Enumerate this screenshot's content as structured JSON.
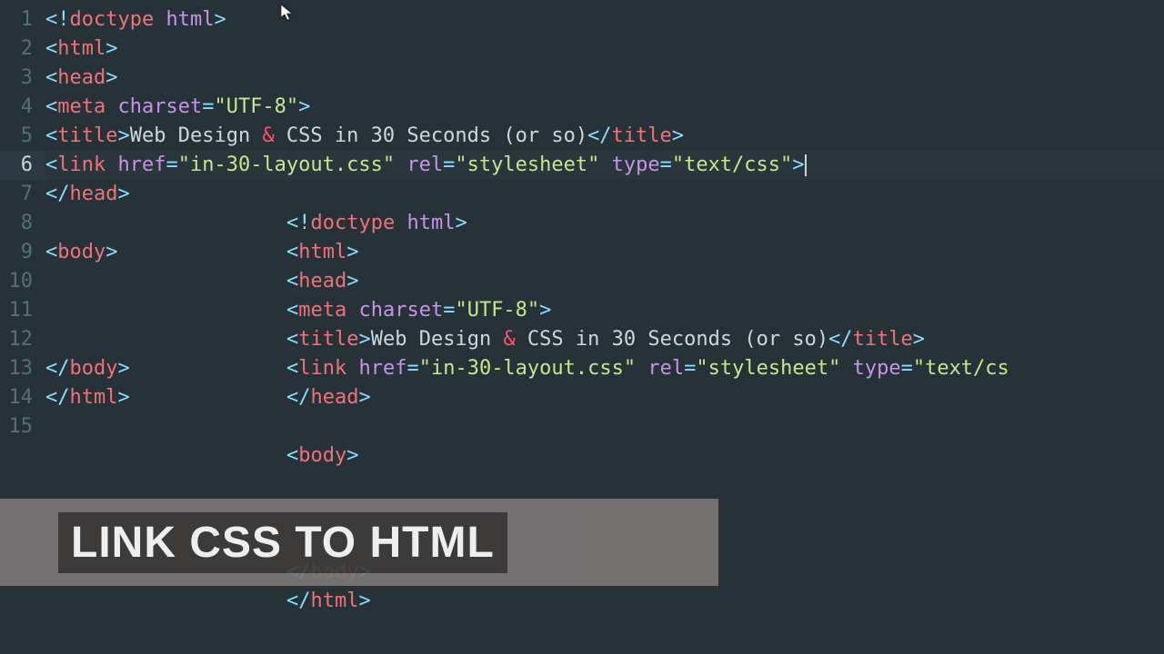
{
  "banner": {
    "text": "LINK CSS TO HTML"
  },
  "active_line": 6,
  "main_lines": [
    {
      "n": 1,
      "tokens": [
        {
          "c": "b",
          "t": "<!"
        },
        {
          "c": "t",
          "t": "doctype"
        },
        {
          "c": "x",
          "t": " "
        },
        {
          "c": "a",
          "t": "html"
        },
        {
          "c": "b",
          "t": ">"
        }
      ]
    },
    {
      "n": 2,
      "tokens": [
        {
          "c": "b",
          "t": "<"
        },
        {
          "c": "t",
          "t": "html"
        },
        {
          "c": "b",
          "t": ">"
        }
      ]
    },
    {
      "n": 3,
      "tokens": [
        {
          "c": "b",
          "t": "<"
        },
        {
          "c": "t",
          "t": "head"
        },
        {
          "c": "b",
          "t": ">"
        }
      ]
    },
    {
      "n": 4,
      "tokens": [
        {
          "c": "b",
          "t": "<"
        },
        {
          "c": "t",
          "t": "meta"
        },
        {
          "c": "x",
          "t": " "
        },
        {
          "c": "a",
          "t": "charset"
        },
        {
          "c": "o",
          "t": "="
        },
        {
          "c": "s",
          "t": "\"UTF-8\""
        },
        {
          "c": "b",
          "t": ">"
        }
      ]
    },
    {
      "n": 5,
      "tokens": [
        {
          "c": "b",
          "t": "<"
        },
        {
          "c": "t",
          "t": "title"
        },
        {
          "c": "b",
          "t": ">"
        },
        {
          "c": "x",
          "t": "Web Design "
        },
        {
          "c": "e",
          "t": "&"
        },
        {
          "c": "x",
          "t": " CSS in 30 Seconds (or so)"
        },
        {
          "c": "b",
          "t": "</"
        },
        {
          "c": "t",
          "t": "title"
        },
        {
          "c": "b",
          "t": ">"
        }
      ]
    },
    {
      "n": 6,
      "tokens": [
        {
          "c": "b",
          "t": "<"
        },
        {
          "c": "t",
          "t": "link"
        },
        {
          "c": "x",
          "t": " "
        },
        {
          "c": "a",
          "t": "href"
        },
        {
          "c": "o",
          "t": "="
        },
        {
          "c": "s",
          "t": "\"in-30-layout.css\""
        },
        {
          "c": "x",
          "t": " "
        },
        {
          "c": "a",
          "t": "rel"
        },
        {
          "c": "o",
          "t": "="
        },
        {
          "c": "s",
          "t": "\"stylesheet\""
        },
        {
          "c": "x",
          "t": " "
        },
        {
          "c": "a",
          "t": "type"
        },
        {
          "c": "o",
          "t": "="
        },
        {
          "c": "s",
          "t": "\"text/css\""
        },
        {
          "c": "b",
          "t": ">"
        }
      ],
      "cursor": true
    },
    {
      "n": 7,
      "tokens": [
        {
          "c": "b",
          "t": "</"
        },
        {
          "c": "t",
          "t": "head"
        },
        {
          "c": "b",
          "t": ">"
        }
      ]
    },
    {
      "n": 8,
      "tokens": []
    },
    {
      "n": 9,
      "tokens": [
        {
          "c": "b",
          "t": "<"
        },
        {
          "c": "t",
          "t": "body"
        },
        {
          "c": "b",
          "t": ">"
        }
      ]
    },
    {
      "n": 10,
      "tokens": []
    },
    {
      "n": 11,
      "tokens": []
    },
    {
      "n": 12,
      "tokens": []
    },
    {
      "n": 13,
      "tokens": [
        {
          "c": "b",
          "t": "</"
        },
        {
          "c": "t",
          "t": "body"
        },
        {
          "c": "b",
          "t": ">"
        }
      ]
    },
    {
      "n": 14,
      "tokens": [
        {
          "c": "b",
          "t": "</"
        },
        {
          "c": "t",
          "t": "html"
        },
        {
          "c": "b",
          "t": ">"
        }
      ]
    },
    {
      "n": 15,
      "tokens": []
    }
  ],
  "secondary_lines": [
    {
      "tokens": [
        {
          "c": "b",
          "t": "<!"
        },
        {
          "c": "t",
          "t": "doctype"
        },
        {
          "c": "x",
          "t": " "
        },
        {
          "c": "a",
          "t": "html"
        },
        {
          "c": "b",
          "t": ">"
        }
      ]
    },
    {
      "tokens": [
        {
          "c": "b",
          "t": "<"
        },
        {
          "c": "t",
          "t": "html"
        },
        {
          "c": "b",
          "t": ">"
        }
      ]
    },
    {
      "tokens": [
        {
          "c": "b",
          "t": "<"
        },
        {
          "c": "t",
          "t": "head"
        },
        {
          "c": "b",
          "t": ">"
        }
      ]
    },
    {
      "tokens": [
        {
          "c": "b",
          "t": "<"
        },
        {
          "c": "t",
          "t": "meta"
        },
        {
          "c": "x",
          "t": " "
        },
        {
          "c": "a",
          "t": "charset"
        },
        {
          "c": "o",
          "t": "="
        },
        {
          "c": "s",
          "t": "\"UTF-8\""
        },
        {
          "c": "b",
          "t": ">"
        }
      ]
    },
    {
      "tokens": [
        {
          "c": "b",
          "t": "<"
        },
        {
          "c": "t",
          "t": "title"
        },
        {
          "c": "b",
          "t": ">"
        },
        {
          "c": "x",
          "t": "Web Design "
        },
        {
          "c": "e",
          "t": "&"
        },
        {
          "c": "x",
          "t": " CSS in 30 Seconds (or so)"
        },
        {
          "c": "b",
          "t": "</"
        },
        {
          "c": "t",
          "t": "title"
        },
        {
          "c": "b",
          "t": ">"
        }
      ]
    },
    {
      "tokens": [
        {
          "c": "b",
          "t": "<"
        },
        {
          "c": "t",
          "t": "link"
        },
        {
          "c": "x",
          "t": " "
        },
        {
          "c": "a",
          "t": "href"
        },
        {
          "c": "o",
          "t": "="
        },
        {
          "c": "s",
          "t": "\"in-30-layout.css\""
        },
        {
          "c": "x",
          "t": " "
        },
        {
          "c": "a",
          "t": "rel"
        },
        {
          "c": "o",
          "t": "="
        },
        {
          "c": "s",
          "t": "\"stylesheet\""
        },
        {
          "c": "x",
          "t": " "
        },
        {
          "c": "a",
          "t": "type"
        },
        {
          "c": "o",
          "t": "="
        },
        {
          "c": "s",
          "t": "\"text/cs"
        }
      ]
    },
    {
      "tokens": [
        {
          "c": "b",
          "t": "</"
        },
        {
          "c": "t",
          "t": "head"
        },
        {
          "c": "b",
          "t": ">"
        }
      ]
    },
    {
      "tokens": []
    },
    {
      "tokens": [
        {
          "c": "b",
          "t": "<"
        },
        {
          "c": "t",
          "t": "body"
        },
        {
          "c": "b",
          "t": ">"
        }
      ]
    },
    {
      "tokens": []
    },
    {
      "tokens": []
    },
    {
      "tokens": []
    },
    {
      "tokens": [
        {
          "c": "b",
          "t": "</"
        },
        {
          "c": "t",
          "t": "body"
        },
        {
          "c": "b",
          "t": ">"
        }
      ]
    },
    {
      "tokens": [
        {
          "c": "b",
          "t": "</"
        },
        {
          "c": "t",
          "t": "html"
        },
        {
          "c": "b",
          "t": ">"
        }
      ]
    }
  ]
}
